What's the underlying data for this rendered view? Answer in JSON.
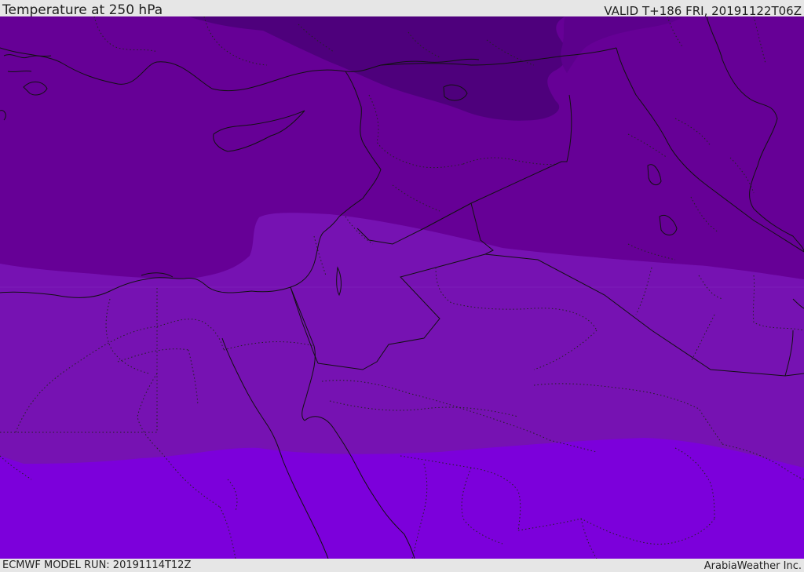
{
  "header": {
    "title": "Temperature at 250 hPa",
    "valid_time": "VALID T+186 FRI, 20191122T06Z"
  },
  "footer": {
    "model_run": "ECMWF MODEL RUN: 20191114T12Z",
    "credit": "ArabiaWeather Inc."
  },
  "map": {
    "region": "Eastern Mediterranean / Middle East",
    "field": "temperature",
    "level": "250 hPa",
    "bands": [
      {
        "name": "coldest",
        "color": "#4e007c"
      },
      {
        "name": "cold",
        "color": "#660096"
      },
      {
        "name": "mid",
        "color": "#7612b2"
      },
      {
        "name": "warm",
        "color": "#7c00db"
      }
    ],
    "line_colors": {
      "borders": "#111111",
      "coast": "#111111"
    }
  }
}
